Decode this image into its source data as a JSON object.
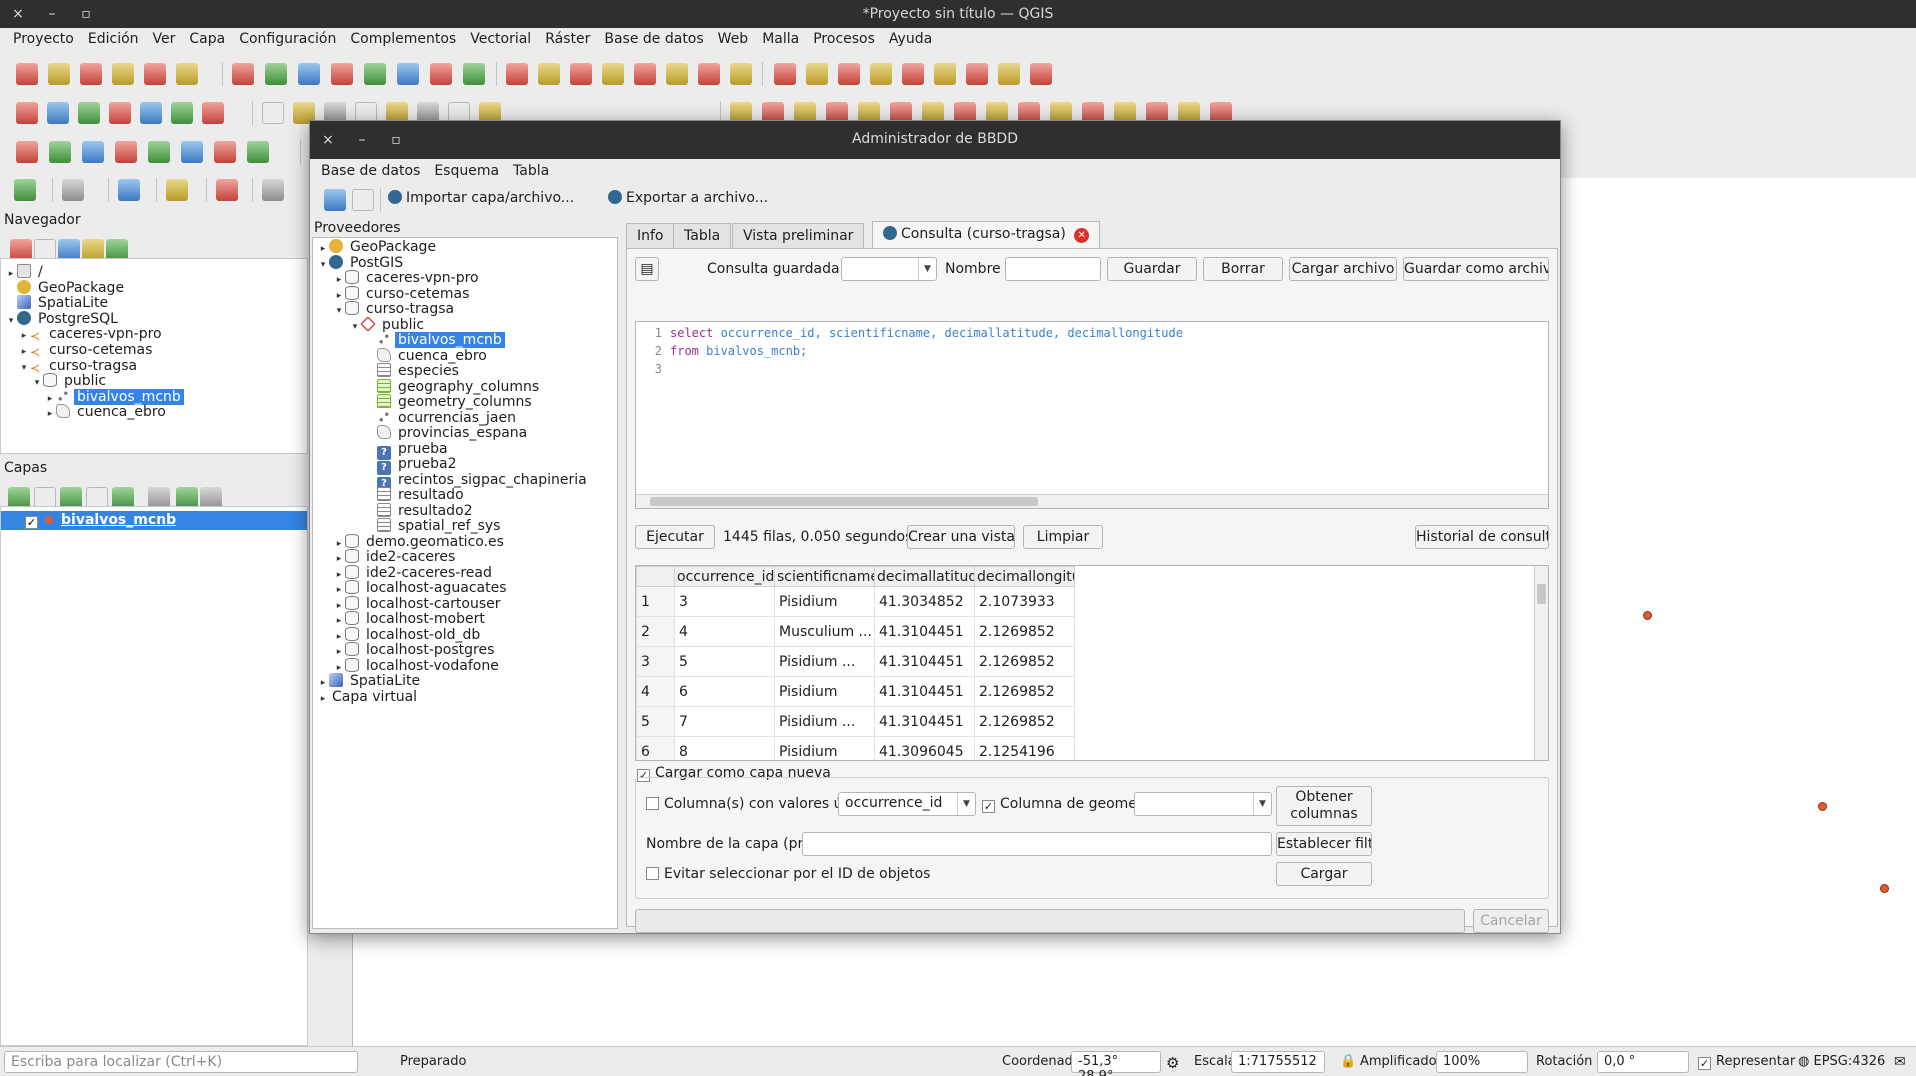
{
  "window": {
    "title": "*Proyecto sin título — QGIS",
    "close": "×",
    "minimize": "–",
    "maximize": "▫"
  },
  "menu": [
    "Proyecto",
    "Edición",
    "Ver",
    "Capa",
    "Configuración",
    "Complementos",
    "Vectorial",
    "Ráster",
    "Base de datos",
    "Web",
    "Malla",
    "Procesos",
    "Ayuda"
  ],
  "navigator": {
    "title": "Navegador",
    "items": [
      {
        "label": "/",
        "indent": 0,
        "arrow": "▸",
        "icon": "folder"
      },
      {
        "label": "GeoPackage",
        "indent": 0,
        "arrow": "",
        "icon": "gp"
      },
      {
        "label": "SpatiaLite",
        "indent": 0,
        "arrow": "",
        "icon": "sl"
      },
      {
        "label": "PostgreSQL",
        "indent": 0,
        "arrow": "▾",
        "icon": "pg"
      },
      {
        "label": "caceres-vpn-pro",
        "indent": 1,
        "arrow": "▸",
        "icon": "key"
      },
      {
        "label": "curso-cetemas",
        "indent": 1,
        "arrow": "▸",
        "icon": "key"
      },
      {
        "label": "curso-tragsa",
        "indent": 1,
        "arrow": "▾",
        "icon": "key"
      },
      {
        "label": "public",
        "indent": 2,
        "arrow": "▾",
        "icon": "db"
      },
      {
        "label": "bivalvos_mcnb",
        "indent": 3,
        "arrow": "▸",
        "icon": "pts",
        "selected": true
      },
      {
        "label": "cuenca_ebro",
        "indent": 3,
        "arrow": "▸",
        "icon": "poly"
      }
    ]
  },
  "layers": {
    "title": "Capas",
    "items": [
      {
        "label": "bivalvos_mcnb",
        "checked": "✓",
        "selected": true
      }
    ]
  },
  "status": {
    "locator_placeholder": "Escriba para localizar (Ctrl+K)",
    "ready": "Preparado",
    "coord_label": "Coordenada",
    "coord_value": "-51,3° 28,9°",
    "scale_label": "Escala",
    "scale_value": "1:71755512",
    "magnifier_label": "Amplificador",
    "magnifier_value": "100%",
    "rotation_label": "Rotación",
    "rotation_value": "0,0 °",
    "render_label": "Representar",
    "crs": "EPSG:4326"
  },
  "dialog": {
    "title": "Administrador de BBDD",
    "menu": [
      "Base de datos",
      "Esquema",
      "Tabla"
    ],
    "toolbar": {
      "import": "Importar capa/archivo...",
      "export": "Exportar a archivo..."
    },
    "providers_label": "Proveedores",
    "providers": [
      {
        "label": "GeoPackage",
        "indent": 0,
        "arrow": "▸",
        "icon": "gp"
      },
      {
        "label": "PostGIS",
        "indent": 0,
        "arrow": "▾",
        "icon": "pg"
      },
      {
        "label": "caceres-vpn-pro",
        "indent": 1,
        "arrow": "▸",
        "icon": "db"
      },
      {
        "label": "curso-cetemas",
        "indent": 1,
        "arrow": "▸",
        "icon": "db"
      },
      {
        "label": "curso-tragsa",
        "indent": 1,
        "arrow": "▾",
        "icon": "db"
      },
      {
        "label": "public",
        "indent": 2,
        "arrow": "▾",
        "icon": "schema"
      },
      {
        "label": "bivalvos_mcnb",
        "indent": 3,
        "arrow": "",
        "icon": "pts",
        "selected": true
      },
      {
        "label": "cuenca_ebro",
        "indent": 3,
        "arrow": "",
        "icon": "poly"
      },
      {
        "label": "especies",
        "indent": 3,
        "arrow": "",
        "icon": "tbl"
      },
      {
        "label": "geography_columns",
        "indent": 3,
        "arrow": "",
        "icon": "view"
      },
      {
        "label": "geometry_columns",
        "indent": 3,
        "arrow": "",
        "icon": "view"
      },
      {
        "label": "ocurrencias_jaen",
        "indent": 3,
        "arrow": "",
        "icon": "pts"
      },
      {
        "label": "provincias_espana",
        "indent": 3,
        "arrow": "",
        "icon": "poly"
      },
      {
        "label": "prueba",
        "indent": 3,
        "arrow": "",
        "icon": "q"
      },
      {
        "label": "prueba2",
        "indent": 3,
        "arrow": "",
        "icon": "q"
      },
      {
        "label": "recintos_sigpac_chapineria",
        "indent": 3,
        "arrow": "",
        "icon": "q"
      },
      {
        "label": "resultado",
        "indent": 3,
        "arrow": "",
        "icon": "tbl"
      },
      {
        "label": "resultado2",
        "indent": 3,
        "arrow": "",
        "icon": "tbl"
      },
      {
        "label": "spatial_ref_sys",
        "indent": 3,
        "arrow": "",
        "icon": "tbl"
      },
      {
        "label": "demo.geomatico.es",
        "indent": 1,
        "arrow": "▸",
        "icon": "db"
      },
      {
        "label": "ide2-caceres",
        "indent": 1,
        "arrow": "▸",
        "icon": "db"
      },
      {
        "label": "ide2-caceres-read",
        "indent": 1,
        "arrow": "▸",
        "icon": "db"
      },
      {
        "label": "localhost-aguacates",
        "indent": 1,
        "arrow": "▸",
        "icon": "db"
      },
      {
        "label": "localhost-cartouser",
        "indent": 1,
        "arrow": "▸",
        "icon": "db"
      },
      {
        "label": "localhost-mobert",
        "indent": 1,
        "arrow": "▸",
        "icon": "db"
      },
      {
        "label": "localhost-old_db",
        "indent": 1,
        "arrow": "▸",
        "icon": "db"
      },
      {
        "label": "localhost-postgres",
        "indent": 1,
        "arrow": "▸",
        "icon": "db"
      },
      {
        "label": "localhost-vodafone",
        "indent": 1,
        "arrow": "▸",
        "icon": "db"
      },
      {
        "label": "SpatiaLite",
        "indent": 0,
        "arrow": "▸",
        "icon": "sl"
      },
      {
        "label": "Capa virtual",
        "indent": 0,
        "arrow": "▸",
        "icon": ""
      }
    ],
    "tabs": {
      "info": "Info",
      "table": "Tabla",
      "preview": "Vista preliminar",
      "query": "Consulta (curso-tragsa)"
    },
    "query": {
      "saved_label": "Consulta guardada",
      "name_label": "Nombre",
      "save": "Guardar",
      "delete": "Borrar",
      "load_file": "Cargar archivo",
      "save_file": "Guardar como archivo",
      "sql_lines": [
        {
          "n": "1",
          "kw": "select",
          "rest": " occurrence_id, scientificname, decimallatitude, decimallongitude"
        },
        {
          "n": "2",
          "kw": "from",
          "rest": " bivalvos_mcnb;"
        },
        {
          "n": "3",
          "kw": "",
          "rest": ""
        }
      ],
      "execute": "Ejecutar",
      "result_info": "1445 filas, 0.050 segundos",
      "create_view": "Crear una vista",
      "clear": "Limpiar",
      "history": "Historial de consultas",
      "columns": [
        "occurrence_id",
        "scientificname",
        "decimallatitude",
        "decimallongitude"
      ],
      "rows": [
        {
          "n": "1",
          "c": [
            "3",
            "Pisidium",
            "41.3034852",
            "2.1073933"
          ]
        },
        {
          "n": "2",
          "c": [
            "4",
            "Musculium ...",
            "41.3104451",
            "2.1269852"
          ]
        },
        {
          "n": "3",
          "c": [
            "5",
            "Pisidium ...",
            "41.3104451",
            "2.1269852"
          ]
        },
        {
          "n": "4",
          "c": [
            "6",
            "Pisidium",
            "41.3104451",
            "2.1269852"
          ]
        },
        {
          "n": "5",
          "c": [
            "7",
            "Pisidium ...",
            "41.3104451",
            "2.1269852"
          ]
        },
        {
          "n": "6",
          "c": [
            "8",
            "Pisidium",
            "41.3096045",
            "2.1254196"
          ]
        }
      ],
      "load_as_layer": "Cargar como capa nueva",
      "unique_cols_label": "Columna(s) con valores únicos",
      "unique_cols_value": "occurrence_id",
      "geom_col_label": "Columna de geometría",
      "get_columns": "Obtener columnas",
      "layer_name_label": "Nombre de la capa (prefijo)",
      "set_filter": "Establecer filtro",
      "avoid_select_label": "Evitar seleccionar por el ID de objetos",
      "load": "Cargar",
      "cancel": "Cancelar"
    }
  },
  "colors": {
    "selection": "#3584e4",
    "titlebar": "#2f2f2f",
    "point": "#e05a30"
  }
}
